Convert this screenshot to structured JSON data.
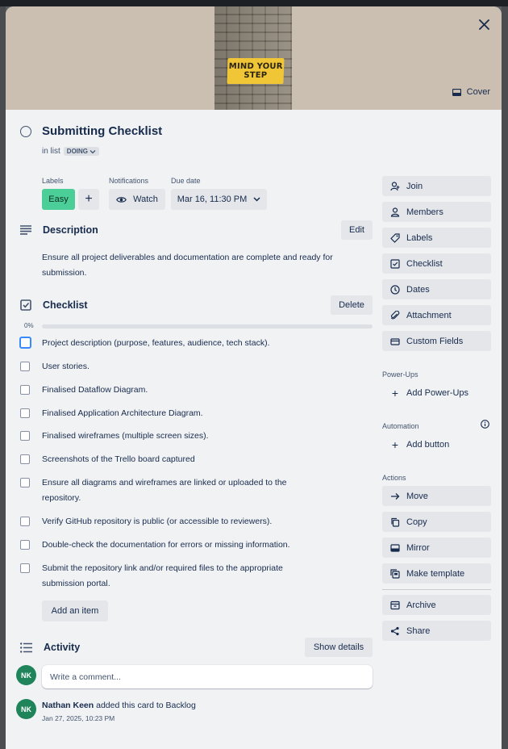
{
  "cover": {
    "sign_line1": "MIND YOUR",
    "sign_line2": "STEP",
    "cover_button_label": "Cover",
    "colors": {
      "background": "#cbbfb2",
      "sign": "#f0c536"
    }
  },
  "card": {
    "title": "Submitting Checklist",
    "in_list_prefix": "in list",
    "list_name": "DOING"
  },
  "meta": {
    "labels_heading": "Labels",
    "label_easy": "Easy",
    "add_label_symbol": "+",
    "notifications_heading": "Notifications",
    "watch_label": "Watch",
    "due_date_heading": "Due date",
    "due_date_value": "Mar 16, 11:30 PM",
    "label_color": "#4bce97"
  },
  "description": {
    "heading": "Description",
    "edit_label": "Edit",
    "text": "Ensure all project deliverables and documentation are complete and ready for submission."
  },
  "checklist": {
    "heading": "Checklist",
    "delete_label": "Delete",
    "progress_text": "0%",
    "progress_fraction": 0,
    "items": [
      {
        "text": "Project description (purpose, features, audience, tech stack).",
        "checked": false
      },
      {
        "text": "User stories.",
        "checked": false
      },
      {
        "text": "Finalised Dataflow Diagram.",
        "checked": false
      },
      {
        "text": "Finalised Application Architecture Diagram.",
        "checked": false
      },
      {
        "text": "Finalised wireframes (multiple screen sizes).",
        "checked": false
      },
      {
        "text": "Screenshots of the Trello board captured",
        "checked": false
      },
      {
        "text": "Ensure all diagrams and wireframes are linked or uploaded to the repository.",
        "checked": false
      },
      {
        "text": "Verify GitHub repository is public (or accessible to reviewers).",
        "checked": false
      },
      {
        "text": "Double-check the documentation for errors or missing information.",
        "checked": false
      },
      {
        "text": "Submit the repository link and/or required files to the appropriate submission portal.",
        "checked": false
      }
    ],
    "add_item_label": "Add an item"
  },
  "activity": {
    "heading": "Activity",
    "show_details_label": "Show details",
    "comment_placeholder": "Write a comment...",
    "user_initials": "NK",
    "entries": [
      {
        "initials": "NK",
        "user": "Nathan Keen",
        "action": " added this card to Backlog",
        "time": "Jan 27, 2025, 10:23 PM"
      }
    ],
    "avatar_color": "#1f845a"
  },
  "sidebar": {
    "add_to_card": [
      {
        "label": "Join",
        "icon": "join-icon"
      },
      {
        "label": "Members",
        "icon": "person-icon"
      },
      {
        "label": "Labels",
        "icon": "tag-icon"
      },
      {
        "label": "Checklist",
        "icon": "checkbox-icon"
      },
      {
        "label": "Dates",
        "icon": "clock-icon"
      },
      {
        "label": "Attachment",
        "icon": "paperclip-icon"
      },
      {
        "label": "Custom Fields",
        "icon": "field-icon"
      }
    ],
    "powerups_heading": "Power-Ups",
    "add_powerups_label": "Add Power-Ups",
    "automation_heading": "Automation",
    "add_button_label": "Add button",
    "actions_heading": "Actions",
    "actions": [
      {
        "label": "Move",
        "icon": "arrow-right-icon"
      },
      {
        "label": "Copy",
        "icon": "copy-icon"
      },
      {
        "label": "Mirror",
        "icon": "mirror-icon"
      },
      {
        "label": "Make template",
        "icon": "template-icon"
      },
      {
        "label": "Archive",
        "icon": "archive-icon"
      },
      {
        "label": "Share",
        "icon": "share-icon"
      }
    ]
  }
}
